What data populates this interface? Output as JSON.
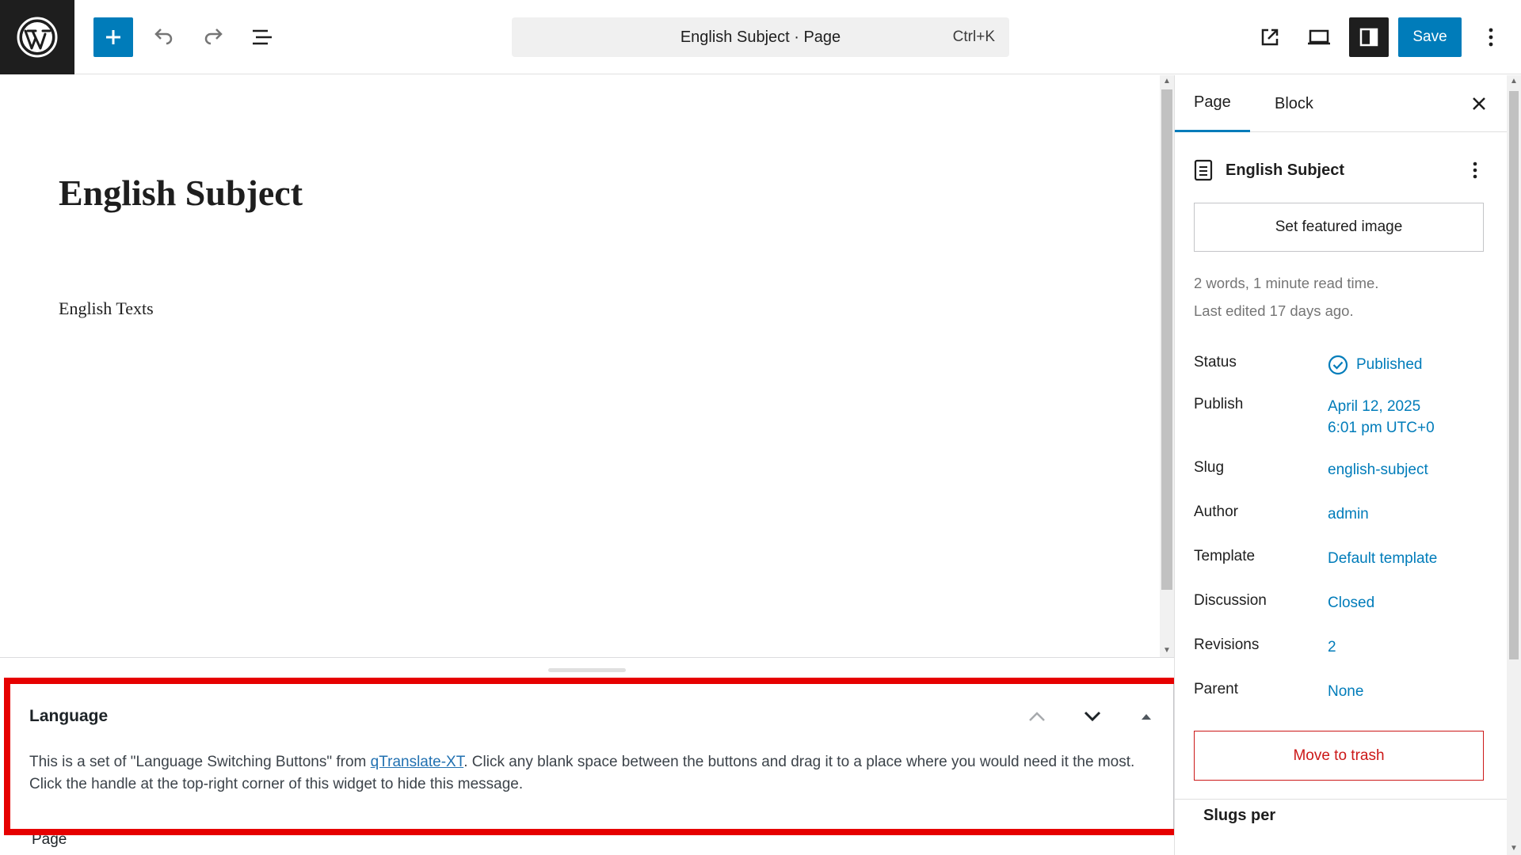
{
  "header": {
    "document_title": "English Subject · Page",
    "shortcut": "Ctrl+K",
    "save_label": "Save"
  },
  "canvas": {
    "title": "English Subject",
    "paragraph": "English Texts"
  },
  "language_box": {
    "title": "Language",
    "desc_before": "This is a set of \"Language Switching Buttons\" from ",
    "link_text": "qTranslate-XT",
    "desc_after": ". Click any blank space between the buttons and drag it to a place where you would need it the most. Click the handle at the top-right corner of this widget to hide this message."
  },
  "footer_label": "Page",
  "sidebar": {
    "tabs": [
      {
        "label": "Page"
      },
      {
        "label": "Block"
      }
    ],
    "doc_title": "English Subject",
    "featured_image_label": "Set featured image",
    "word_info": "2 words, 1 minute read time.",
    "last_edited": "Last edited 17 days ago.",
    "rows": {
      "status": {
        "label": "Status",
        "value": "Published"
      },
      "publish": {
        "label": "Publish",
        "value_line1": "April 12, 2025",
        "value_line2": "6:01 pm UTC+0"
      },
      "slug": {
        "label": "Slug",
        "value": "english-subject"
      },
      "author": {
        "label": "Author",
        "value": "admin"
      },
      "template": {
        "label": "Template",
        "value": "Default template"
      },
      "discussion": {
        "label": "Discussion",
        "value": "Closed"
      },
      "revisions": {
        "label": "Revisions",
        "value": "2"
      },
      "parent": {
        "label": "Parent",
        "value": "None"
      }
    },
    "trash_label": "Move to trash",
    "slugs_title": "Slugs per"
  },
  "colors": {
    "accent": "#007cba",
    "danger": "#cc1818",
    "highlight": "#e60000"
  }
}
